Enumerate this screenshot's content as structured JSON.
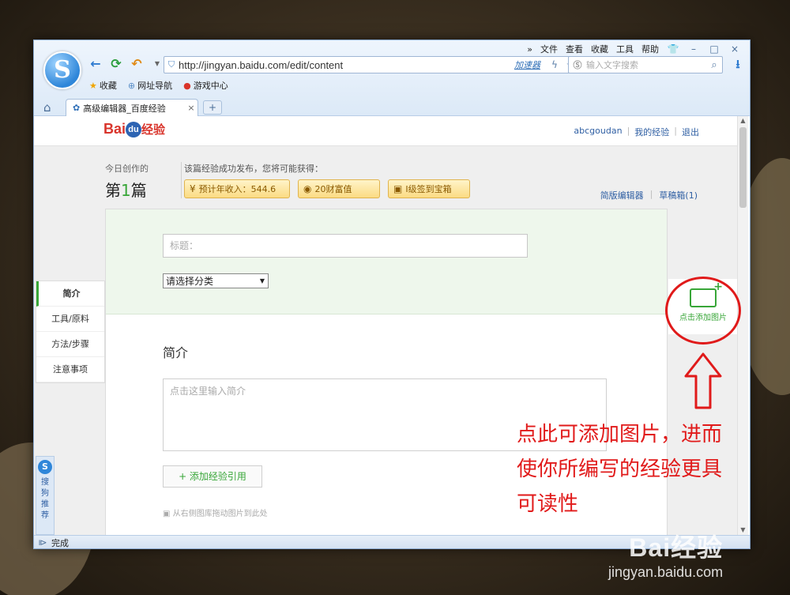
{
  "browser": {
    "menu": [
      "»",
      "文件",
      "查看",
      "收藏",
      "工具",
      "帮助"
    ],
    "window_controls": [
      "👕",
      "–",
      "□",
      "×"
    ],
    "address": "http://jingyan.baidu.com/edit/content",
    "accelerator": "加速器",
    "search_placeholder": "输入文字搜索",
    "favorites": [
      "收藏",
      "网址导航",
      "游戏中心"
    ],
    "tab_title": "高级编辑器_百度经验",
    "newtab": "+",
    "status": "完成"
  },
  "page": {
    "logo_bai": "Bai",
    "logo_du": "du",
    "logo_jingyan": "经验",
    "user_links": [
      "abcgoudan",
      "我的经验",
      "退出"
    ],
    "today_label": "今日创作的",
    "today_prefix": "第",
    "today_num": "1",
    "today_suffix": "篇",
    "gain_label": "该篇经验成功发布，您将可能获得：",
    "badges": [
      "预计年收入：544.6",
      "20财富值",
      "I级签到宝箱"
    ],
    "edit_links": [
      "简版编辑器",
      "草稿箱(1)"
    ],
    "title_placeholder": "标题：",
    "category": "请选择分类",
    "section_title": "简介",
    "intro_placeholder": "点击这里输入简介",
    "add_ref": "+ 添加经验引用",
    "drag_hint": "从右侧图库拖动图片到此处",
    "sidenav": [
      "简介",
      "工具/原料",
      "方法/步骤",
      "注意事项"
    ],
    "add_image": "点击添加图片",
    "sidetool": [
      "S",
      "搜",
      "狗",
      "推",
      "荐"
    ]
  },
  "annotation": {
    "lines": [
      "点此可添加图片，进而",
      "使你所编写的经验更具",
      "可读性"
    ],
    "color": "#e11a1a"
  },
  "watermark": {
    "logo": "Bai经验",
    "url": "jingyan.baidu.com"
  }
}
